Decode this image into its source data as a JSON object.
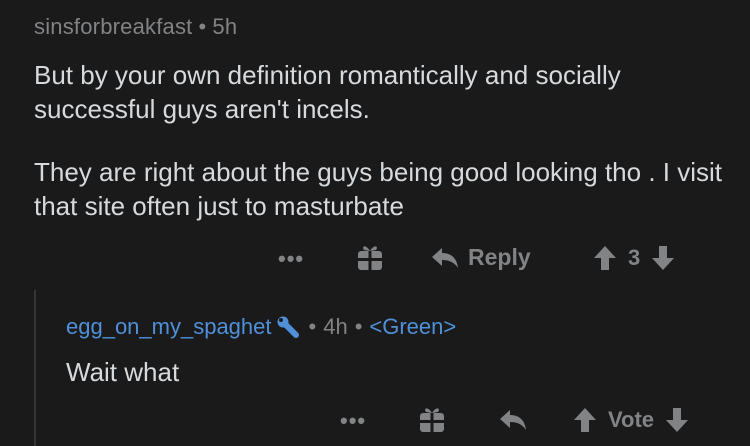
{
  "comment": {
    "username": "sinsforbreakfast",
    "separator": "•",
    "age": "5h",
    "paragraph1": "But by your own definition romantically and socially successful guys aren't incels.",
    "paragraph2": "They are right about the guys being good looking tho . I visit that site often just to masturbate",
    "actions": {
      "more": "•••",
      "reply_label": "Reply",
      "score": "3"
    }
  },
  "reply": {
    "username": "egg_on_my_spaghet",
    "separator": "•",
    "age": "4h",
    "flair": "<Green>",
    "body": "Wait what",
    "actions": {
      "more": "•••",
      "vote_label": "Vote"
    }
  },
  "colors": {
    "background": "#1a1a1b",
    "text": "#d7dadc",
    "muted": "#818384",
    "link_blue": "#4f90d9"
  }
}
